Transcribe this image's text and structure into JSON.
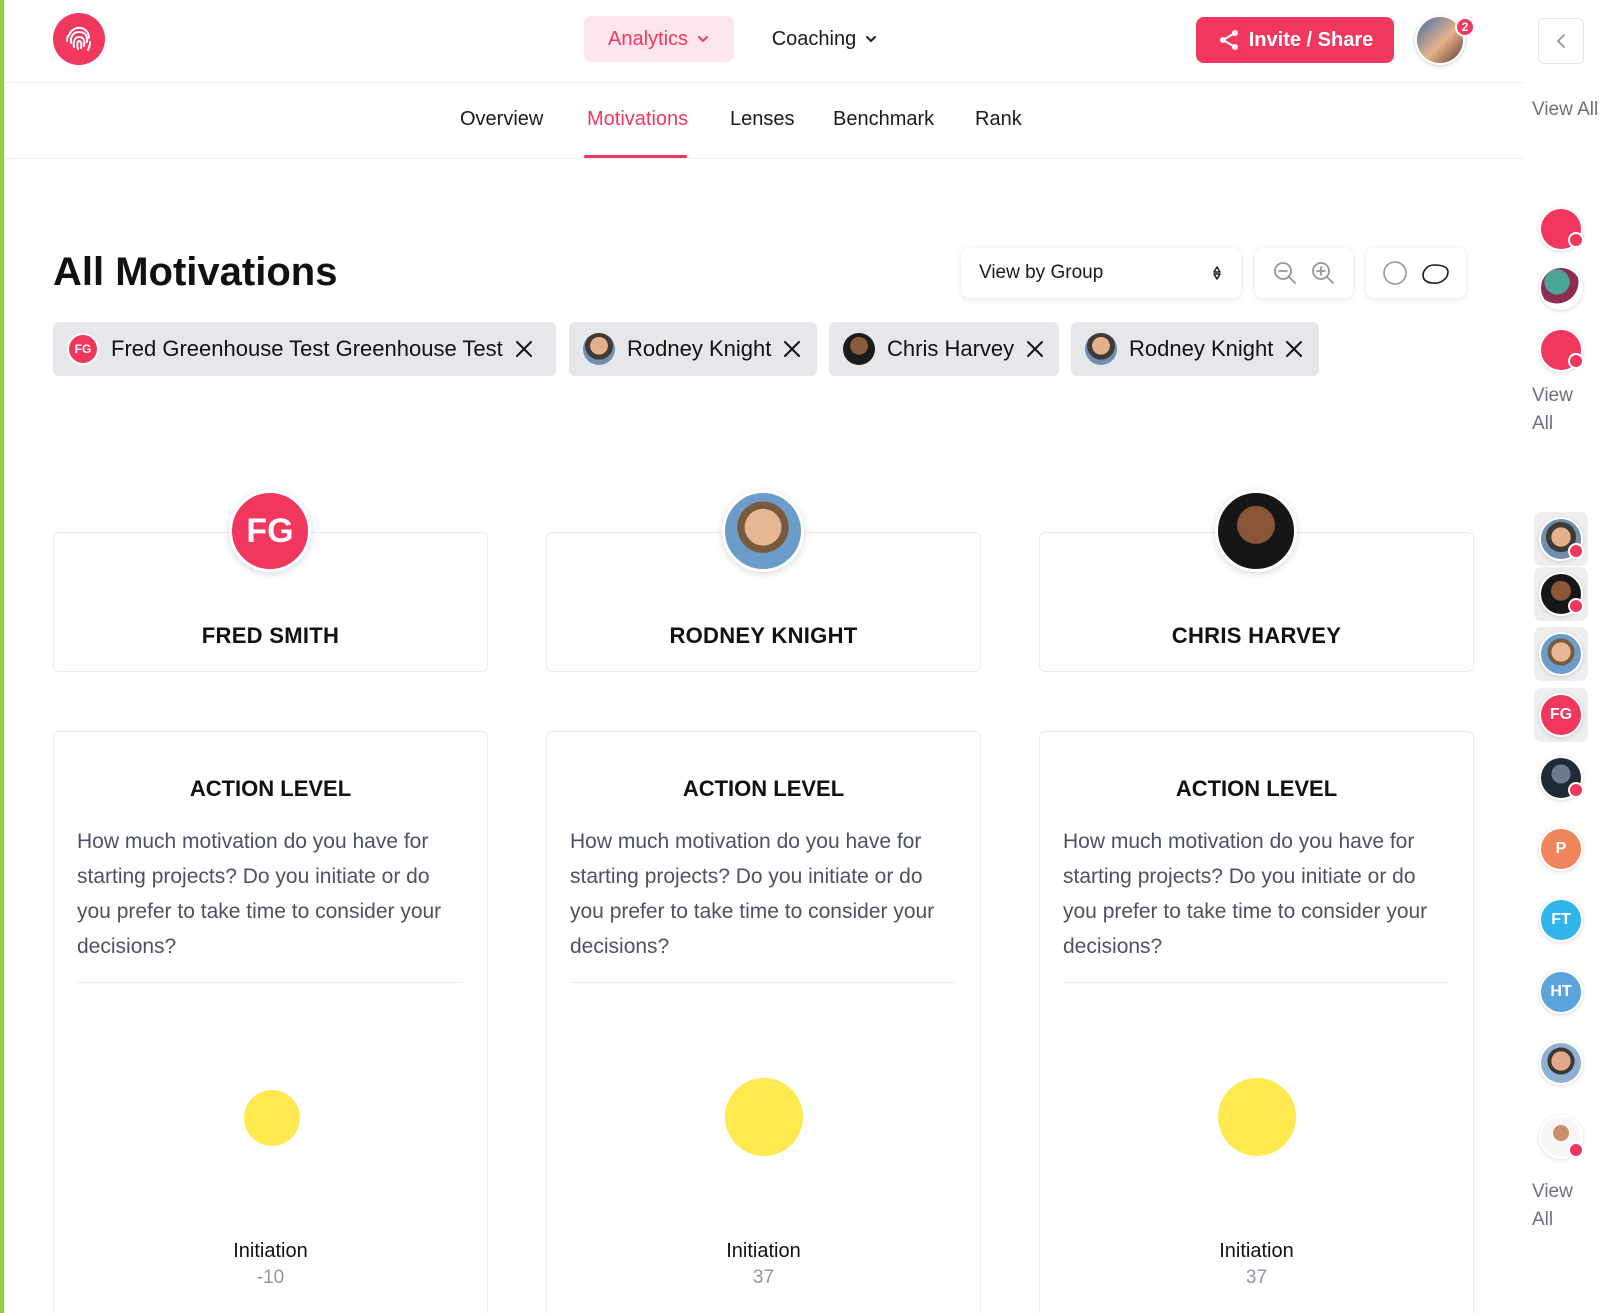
{
  "header": {
    "nav": {
      "analytics": "Analytics",
      "coaching": "Coaching"
    },
    "invite_label": "Invite / Share",
    "notification_count": "2"
  },
  "tabs": [
    "Overview",
    "Motivations",
    "Lenses",
    "Benchmark",
    "Rank"
  ],
  "active_tab": "Motivations",
  "page": {
    "title": "All Motivations",
    "view_select": "View by Group"
  },
  "chips": [
    {
      "label": "Fred Greenhouse Test Greenhouse Test",
      "initials": "FG"
    },
    {
      "label": "Rodney Knight"
    },
    {
      "label": "Chris Harvey"
    },
    {
      "label": "Rodney Knight"
    }
  ],
  "people": [
    {
      "name": "FRED SMITH",
      "initials": "FG"
    },
    {
      "name": "RODNEY KNIGHT"
    },
    {
      "name": "CHRIS HARVEY"
    }
  ],
  "motivation": {
    "title": "ACTION LEVEL",
    "description": "How much motivation do you have for starting projects? Do you initiate or do you prefer to take time to consider your decisions?",
    "dimension": "Initiation",
    "scores": [
      "-10",
      "37",
      "37"
    ]
  },
  "right_sidebar": {
    "view_all_label": "View All",
    "members": [
      {
        "initials": "FG"
      },
      {
        "initials": "P"
      },
      {
        "initials": "FT"
      },
      {
        "initials": "HT"
      }
    ]
  },
  "colors": {
    "brand": "#f2375f",
    "brand_light": "#fde5ec",
    "dot": "#ffe94f",
    "muted_text": "#4a5366"
  }
}
